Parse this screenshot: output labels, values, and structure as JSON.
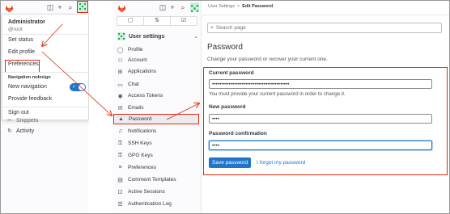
{
  "left_panel": {
    "dropdown": {
      "name": "Administrator",
      "handle": "@root",
      "set_status": "Set status",
      "edit_profile": "Edit profile",
      "preferences": "Preferences",
      "section_label": "Navigation redesign",
      "new_navigation": "New navigation",
      "new_navigation_enabled": true,
      "provide_feedback": "Provide feedback",
      "sign_out": "Sign out"
    },
    "bottom_items": [
      {
        "label": "Snippets",
        "icon": "snippet-icon"
      },
      {
        "label": "Activity",
        "icon": "history-icon"
      }
    ]
  },
  "sidebar": {
    "header": "User settings",
    "items": [
      {
        "label": "Profile",
        "icon": "profile-icon"
      },
      {
        "label": "Account",
        "icon": "account-icon"
      },
      {
        "label": "Applications",
        "icon": "applications-icon"
      },
      {
        "label": "Chat",
        "icon": "chat-icon"
      },
      {
        "label": "Access Tokens",
        "icon": "token-icon"
      },
      {
        "label": "Emails",
        "icon": "mail-icon"
      },
      {
        "label": "Password",
        "icon": "lock-icon"
      },
      {
        "label": "Notifications",
        "icon": "bell-icon"
      },
      {
        "label": "SSH Keys",
        "icon": "key-icon"
      },
      {
        "label": "GPG Keys",
        "icon": "key-icon"
      },
      {
        "label": "Preferences",
        "icon": "preferences-icon"
      },
      {
        "label": "Comment Templates",
        "icon": "comment-icon"
      },
      {
        "label": "Active Sessions",
        "icon": "sessions-icon"
      },
      {
        "label": "Authentication Log",
        "icon": "log-icon"
      }
    ],
    "active_index": 6
  },
  "main": {
    "breadcrumb": {
      "parent": "User Settings",
      "separator": ">",
      "current": "Edit Password"
    },
    "search_placeholder": "Search page",
    "title": "Password",
    "description": "Change your password or recover your current one.",
    "current_password_label": "Current password",
    "current_password_value": "••••••••••••••••••••••••••••••••••••••••••",
    "current_password_help": "You must provide your current password in order to change it.",
    "new_password_label": "New password",
    "new_password_value": "••••",
    "confirm_label": "Password confirmation",
    "confirm_value": "••••",
    "save_button": "Save password",
    "forgot_link": "I forgot my password"
  },
  "colors": {
    "accent": "#1f75cb",
    "annotation": "#dd2b0e",
    "logo": "#e24329"
  }
}
